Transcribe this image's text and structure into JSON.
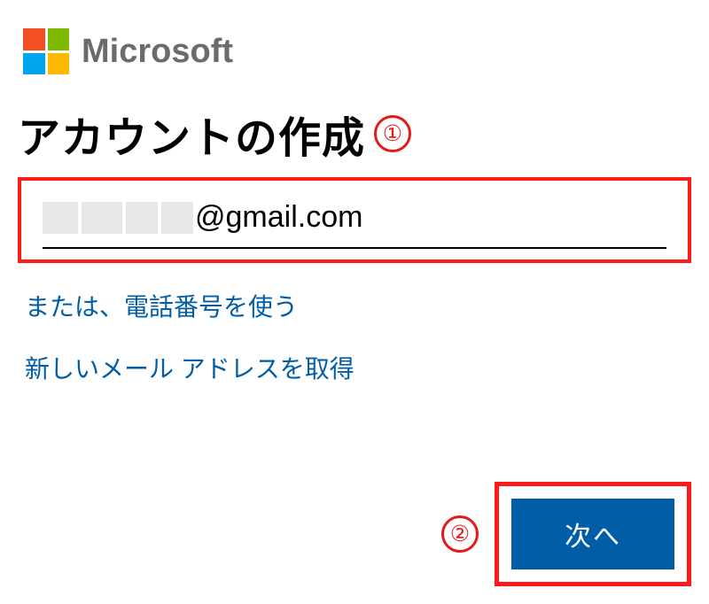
{
  "brand": "Microsoft",
  "title": "アカウントの作成",
  "email": {
    "domain_part": "@gmail.com"
  },
  "links": {
    "use_phone": "または、電話番号を使う",
    "get_new_email": "新しいメール アドレスを取得"
  },
  "buttons": {
    "next": "次へ"
  },
  "annotations": {
    "one": "①",
    "two": "②"
  },
  "colors": {
    "accent": "#005da6",
    "annotation_red": "#ff1a1a"
  }
}
